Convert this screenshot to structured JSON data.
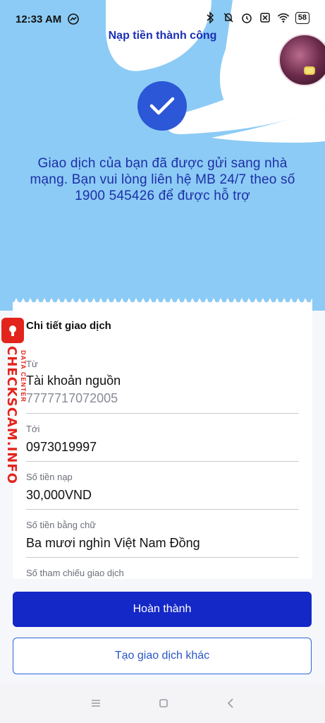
{
  "status_bar": {
    "time": "12:33 AM",
    "battery": "58",
    "icons": [
      "messenger-icon",
      "bluetooth-icon",
      "bell-off-icon",
      "alarm-icon",
      "sim-off-icon",
      "wifi-icon",
      "battery-icon"
    ]
  },
  "header": {
    "title": "Nạp tiền thành công"
  },
  "message": "Giao dịch của bạn đã được gửi sang nhà mạng. Bạn vui lòng liên hệ MB 24/7 theo số 1900 545426 để được hỗ trợ",
  "details": {
    "title": "Chi tiết giao dịch",
    "from_label": "Từ",
    "from_value": "Tài khoản nguồn",
    "from_account": "7777717072005",
    "to_label": "Tới",
    "to_value": "0973019997",
    "amount_label": "Số tiền nạp",
    "amount_value": "30,000VND",
    "amount_words_label": "Số tiền bằng chữ",
    "amount_words_value": "Ba mươi nghìn Việt Nam Đồng",
    "reference_label": "Số tham chiếu giao dịch"
  },
  "watermark": {
    "text": "CHECKSCAM.INFO",
    "sub": "DATA CENTER"
  },
  "actions": {
    "done": "Hoàn thành",
    "new_transaction": "Tạo giao dịch khác"
  },
  "colors": {
    "accent": "#1428c7",
    "sky": "#8ccbf5",
    "check": "#2c57d6",
    "watermark": "#e3241c"
  }
}
